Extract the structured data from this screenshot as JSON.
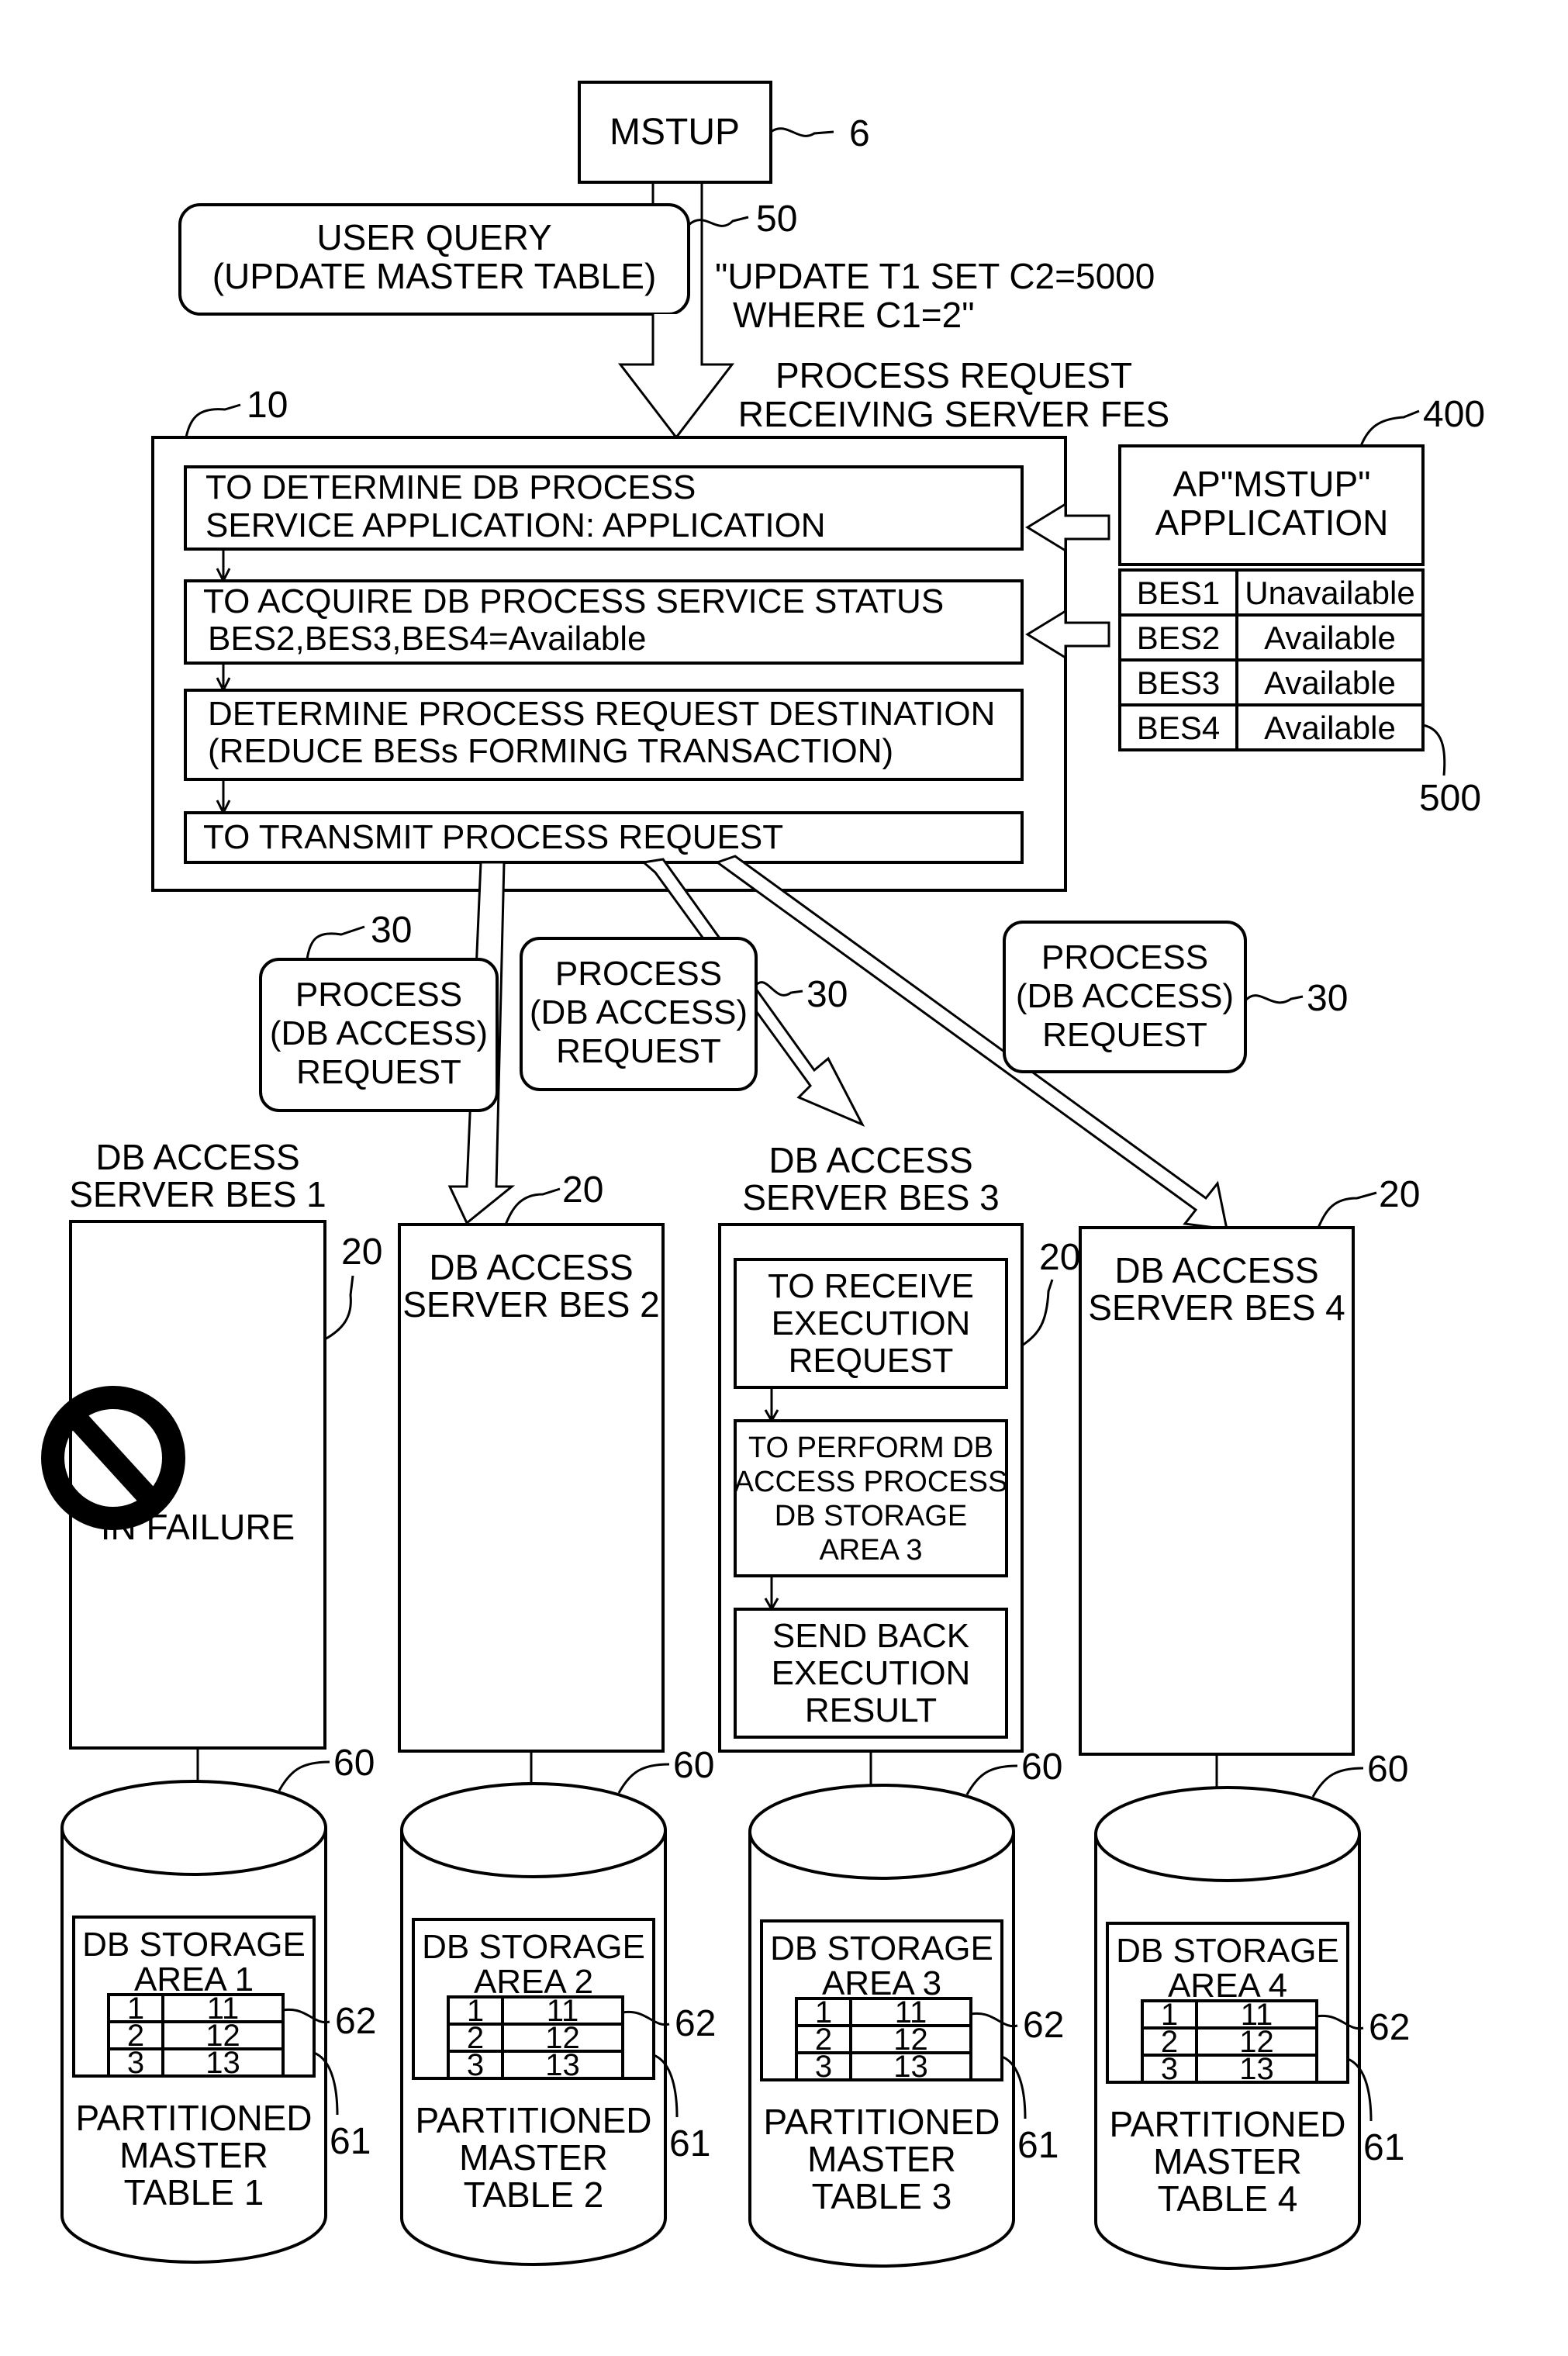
{
  "mstup": {
    "label": "MSTUP",
    "ref": "6"
  },
  "user_query": {
    "lines": [
      "USER QUERY",
      "(UPDATE MASTER TABLE)"
    ],
    "ref": "50"
  },
  "sql": {
    "lines": [
      "\"UPDATE T1 SET C2=5000",
      "WHERE C1=2\""
    ]
  },
  "fes": {
    "title_lines": [
      "PROCESS REQUEST",
      "RECEIVING SERVER FES"
    ],
    "ref": "10",
    "steps": [
      {
        "lines": [
          "TO DETERMINE DB PROCESS",
          "SERVICE APPLICATION: APPLICATION"
        ]
      },
      {
        "lines": [
          "TO ACQUIRE DB PROCESS SERVICE STATUS",
          "BES2,BES3,BES4=Available"
        ]
      },
      {
        "lines": [
          "DETERMINE PROCESS REQUEST DESTINATION",
          "(REDUCE BESs FORMING TRANSACTION)"
        ]
      },
      {
        "lines": [
          "TO TRANSMIT PROCESS REQUEST"
        ]
      }
    ]
  },
  "ap": {
    "lines": [
      "AP\"MSTUP\"",
      "APPLICATION"
    ],
    "ref": "400"
  },
  "status_table": {
    "ref": "500",
    "rows": [
      {
        "server": "BES1",
        "status": "Unavailable"
      },
      {
        "server": "BES2",
        "status": "Available"
      },
      {
        "server": "BES3",
        "status": "Available"
      },
      {
        "server": "BES4",
        "status": "Available"
      }
    ]
  },
  "requests": [
    {
      "lines": [
        "PROCESS",
        "(DB ACCESS)",
        "REQUEST"
      ],
      "ref": "30"
    },
    {
      "lines": [
        "PROCESS",
        "(DB ACCESS)",
        "REQUEST"
      ],
      "ref": "30"
    },
    {
      "lines": [
        "PROCESS",
        "(DB ACCESS)",
        "REQUEST"
      ],
      "ref": "30"
    }
  ],
  "servers": [
    {
      "title_lines": [
        "DB ACCESS",
        "SERVER BES 1"
      ],
      "ref": "20",
      "status": "IN FAILURE"
    },
    {
      "title_lines": [
        "DB ACCESS",
        "SERVER BES 2"
      ],
      "ref": "20"
    },
    {
      "title_lines": [
        "DB ACCESS",
        "SERVER BES 3"
      ],
      "ref": "20",
      "steps": [
        {
          "lines": [
            "TO RECEIVE",
            "EXECUTION",
            "REQUEST"
          ]
        },
        {
          "lines": [
            "TO PERFORM DB",
            "ACCESS PROCESS",
            "DB STORAGE",
            "AREA 3"
          ]
        },
        {
          "lines": [
            "SEND BACK",
            "EXECUTION",
            "RESULT"
          ]
        }
      ]
    },
    {
      "title_lines": [
        "DB ACCESS",
        "SERVER BES 4"
      ],
      "ref": "20"
    }
  ],
  "databases": [
    {
      "ref": "60",
      "area_lines": [
        "DB STORAGE",
        "AREA 1"
      ],
      "area_ref": "61",
      "table_ref": "62",
      "rows": [
        [
          "1",
          "11"
        ],
        [
          "2",
          "12"
        ],
        [
          "3",
          "13"
        ]
      ],
      "label_lines": [
        "PARTITIONED",
        "MASTER",
        "TABLE 1"
      ]
    },
    {
      "ref": "60",
      "area_lines": [
        "DB STORAGE",
        "AREA 2"
      ],
      "area_ref": "61",
      "table_ref": "62",
      "rows": [
        [
          "1",
          "11"
        ],
        [
          "2",
          "12"
        ],
        [
          "3",
          "13"
        ]
      ],
      "label_lines": [
        "PARTITIONED",
        "MASTER",
        "TABLE 2"
      ]
    },
    {
      "ref": "60",
      "area_lines": [
        "DB STORAGE",
        "AREA 3"
      ],
      "area_ref": "61",
      "table_ref": "62",
      "rows": [
        [
          "1",
          "11"
        ],
        [
          "2",
          "12"
        ],
        [
          "3",
          "13"
        ]
      ],
      "label_lines": [
        "PARTITIONED",
        "MASTER",
        "TABLE 3"
      ]
    },
    {
      "ref": "60",
      "area_lines": [
        "DB STORAGE",
        "AREA 4"
      ],
      "area_ref": "61",
      "table_ref": "62",
      "rows": [
        [
          "1",
          "11"
        ],
        [
          "2",
          "12"
        ],
        [
          "3",
          "13"
        ]
      ],
      "label_lines": [
        "PARTITIONED",
        "MASTER",
        "TABLE 4"
      ]
    }
  ]
}
